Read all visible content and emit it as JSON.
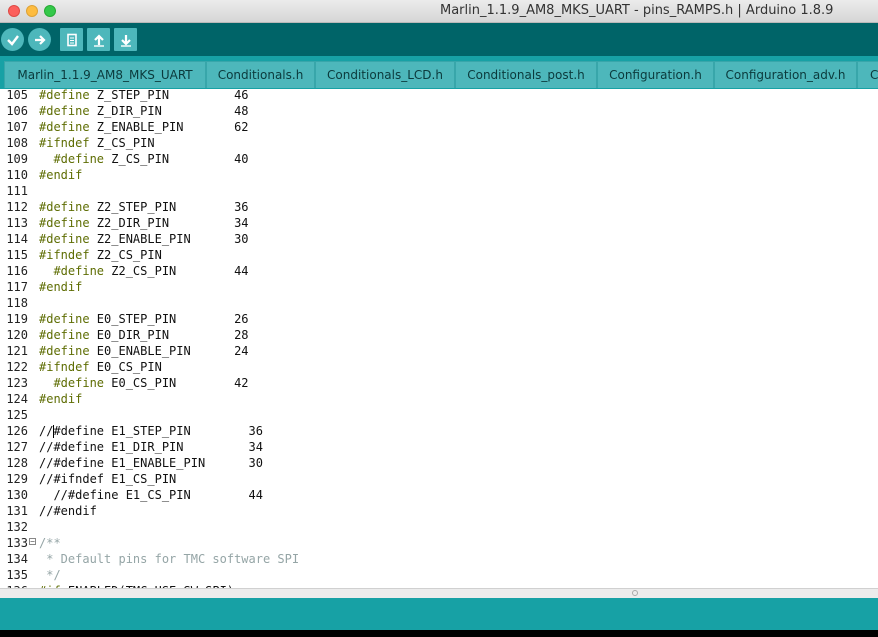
{
  "window": {
    "title": "Marlin_1.1.9_AM8_MKS_UART - pins_RAMPS.h | Arduino 1.8.9"
  },
  "toolbar": {
    "buttons": [
      {
        "name": "verify",
        "icon": "checkmark-icon"
      },
      {
        "name": "upload",
        "icon": "arrow-right-icon"
      },
      {
        "name": "new",
        "icon": "document-icon"
      },
      {
        "name": "open",
        "icon": "arrow-up-icon"
      },
      {
        "name": "save",
        "icon": "arrow-down-icon"
      }
    ]
  },
  "tabs": [
    {
      "label": "Marlin_1.1.9_AM8_MKS_UART"
    },
    {
      "label": "Conditionals.h"
    },
    {
      "label": "Conditionals_LCD.h"
    },
    {
      "label": "Conditionals_post.h"
    },
    {
      "label": "Configuration.h"
    },
    {
      "label": "Configuration_adv.h"
    },
    {
      "label": "C"
    }
  ],
  "editor": {
    "lines": [
      {
        "n": "105",
        "parts": [
          {
            "t": "#define",
            "c": "kw"
          },
          {
            "t": " Z_STEP_PIN         46"
          }
        ]
      },
      {
        "n": "106",
        "parts": [
          {
            "t": "#define",
            "c": "kw"
          },
          {
            "t": " Z_DIR_PIN          48"
          }
        ]
      },
      {
        "n": "107",
        "parts": [
          {
            "t": "#define",
            "c": "kw"
          },
          {
            "t": " Z_ENABLE_PIN       62"
          }
        ]
      },
      {
        "n": "108",
        "parts": [
          {
            "t": "#ifndef",
            "c": "kw"
          },
          {
            "t": " Z_CS_PIN"
          }
        ]
      },
      {
        "n": "109",
        "parts": [
          {
            "t": "  "
          },
          {
            "t": "#define",
            "c": "kw"
          },
          {
            "t": " Z_CS_PIN         40"
          }
        ]
      },
      {
        "n": "110",
        "parts": [
          {
            "t": "#endif",
            "c": "kw"
          }
        ]
      },
      {
        "n": "111",
        "parts": []
      },
      {
        "n": "112",
        "parts": [
          {
            "t": "#define",
            "c": "kw"
          },
          {
            "t": " Z2_STEP_PIN        36"
          }
        ]
      },
      {
        "n": "113",
        "parts": [
          {
            "t": "#define",
            "c": "kw"
          },
          {
            "t": " Z2_DIR_PIN         34"
          }
        ]
      },
      {
        "n": "114",
        "parts": [
          {
            "t": "#define",
            "c": "kw"
          },
          {
            "t": " Z2_ENABLE_PIN      30"
          }
        ]
      },
      {
        "n": "115",
        "parts": [
          {
            "t": "#ifndef",
            "c": "kw"
          },
          {
            "t": " Z2_CS_PIN"
          }
        ]
      },
      {
        "n": "116",
        "parts": [
          {
            "t": "  "
          },
          {
            "t": "#define",
            "c": "kw"
          },
          {
            "t": " Z2_CS_PIN        44"
          }
        ]
      },
      {
        "n": "117",
        "parts": [
          {
            "t": "#endif",
            "c": "kw"
          }
        ]
      },
      {
        "n": "118",
        "parts": []
      },
      {
        "n": "119",
        "parts": [
          {
            "t": "#define",
            "c": "kw"
          },
          {
            "t": " E0_STEP_PIN        26"
          }
        ]
      },
      {
        "n": "120",
        "parts": [
          {
            "t": "#define",
            "c": "kw"
          },
          {
            "t": " E0_DIR_PIN         28"
          }
        ]
      },
      {
        "n": "121",
        "parts": [
          {
            "t": "#define",
            "c": "kw"
          },
          {
            "t": " E0_ENABLE_PIN      24"
          }
        ]
      },
      {
        "n": "122",
        "parts": [
          {
            "t": "#ifndef",
            "c": "kw"
          },
          {
            "t": " E0_CS_PIN"
          }
        ]
      },
      {
        "n": "123",
        "parts": [
          {
            "t": "  "
          },
          {
            "t": "#define",
            "c": "kw"
          },
          {
            "t": " E0_CS_PIN        42"
          }
        ]
      },
      {
        "n": "124",
        "parts": [
          {
            "t": "#endif",
            "c": "kw"
          }
        ]
      },
      {
        "n": "125",
        "parts": []
      },
      {
        "n": "126",
        "cursor": true,
        "parts": [
          {
            "t": "//#define E1_STEP_PIN        36"
          }
        ]
      },
      {
        "n": "127",
        "parts": [
          {
            "t": "//#define E1_DIR_PIN         34"
          }
        ]
      },
      {
        "n": "128",
        "parts": [
          {
            "t": "//#define E1_ENABLE_PIN      30"
          }
        ]
      },
      {
        "n": "129",
        "parts": [
          {
            "t": "//#ifndef E1_CS_PIN"
          }
        ]
      },
      {
        "n": "130",
        "parts": [
          {
            "t": "  //#define E1_CS_PIN        44"
          }
        ]
      },
      {
        "n": "131",
        "parts": [
          {
            "t": "//#endif"
          }
        ]
      },
      {
        "n": "132",
        "parts": []
      },
      {
        "n": "133",
        "fold": "−",
        "parts": [
          {
            "t": "/**",
            "c": "cm"
          }
        ]
      },
      {
        "n": "134",
        "parts": [
          {
            "t": " * Default pins for TMC software SPI",
            "c": "cm"
          }
        ]
      },
      {
        "n": "135",
        "parts": [
          {
            "t": " */",
            "c": "cm"
          }
        ]
      },
      {
        "n": "136",
        "parts": [
          {
            "t": "#if",
            "c": "kw"
          },
          {
            "t": " ENABLED(TMC_USE_SW_SPI)"
          }
        ]
      }
    ]
  }
}
